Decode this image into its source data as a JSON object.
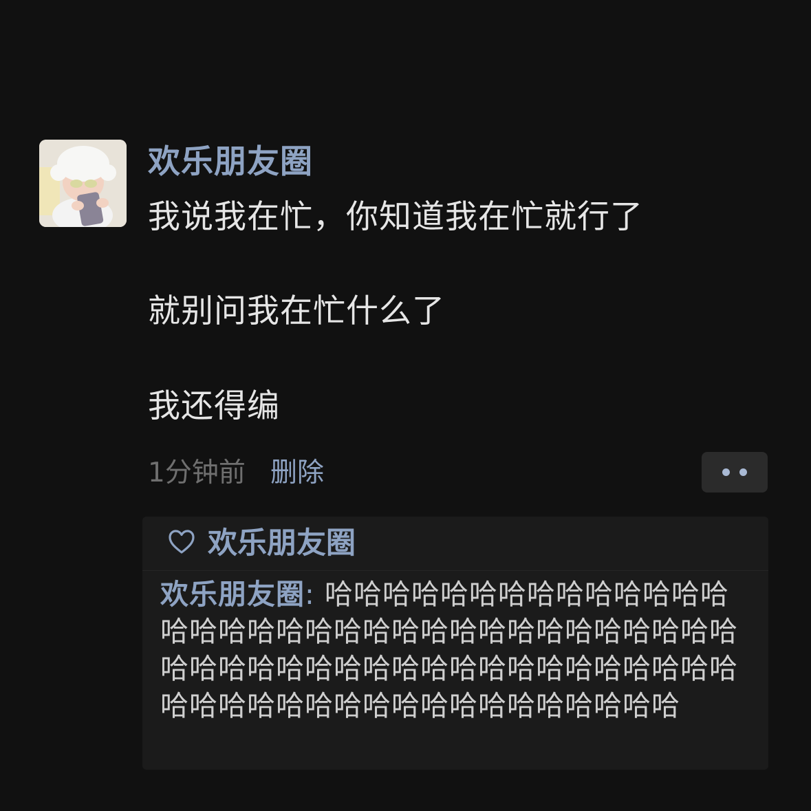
{
  "post": {
    "author": "欢乐朋友圈",
    "content_lines": [
      "我说我在忙，你知道我在忙就行了",
      "就别问我在忙什么了",
      "我还得编"
    ],
    "time": "1分钟前",
    "delete_label": "删除"
  },
  "likes": {
    "icon": "heart-icon",
    "names": "欢乐朋友圈"
  },
  "comments": [
    {
      "author": "欢乐朋友圈",
      "separator": ":",
      "text": "哈哈哈哈哈哈哈哈哈哈哈哈哈哈哈哈哈哈哈哈哈哈哈哈哈哈哈哈哈哈哈哈哈哈哈哈哈哈哈哈哈哈哈哈哈哈哈哈哈哈哈哈哈哈哈哈哈哈哈哈哈哈哈哈哈哈哈哈哈哈哈哈"
    }
  ],
  "colors": {
    "background": "#111111",
    "name": "#8ea3c3",
    "text": "#e6e6e6",
    "muted": "#6f6f6f",
    "panel": "#1b1b1b"
  }
}
